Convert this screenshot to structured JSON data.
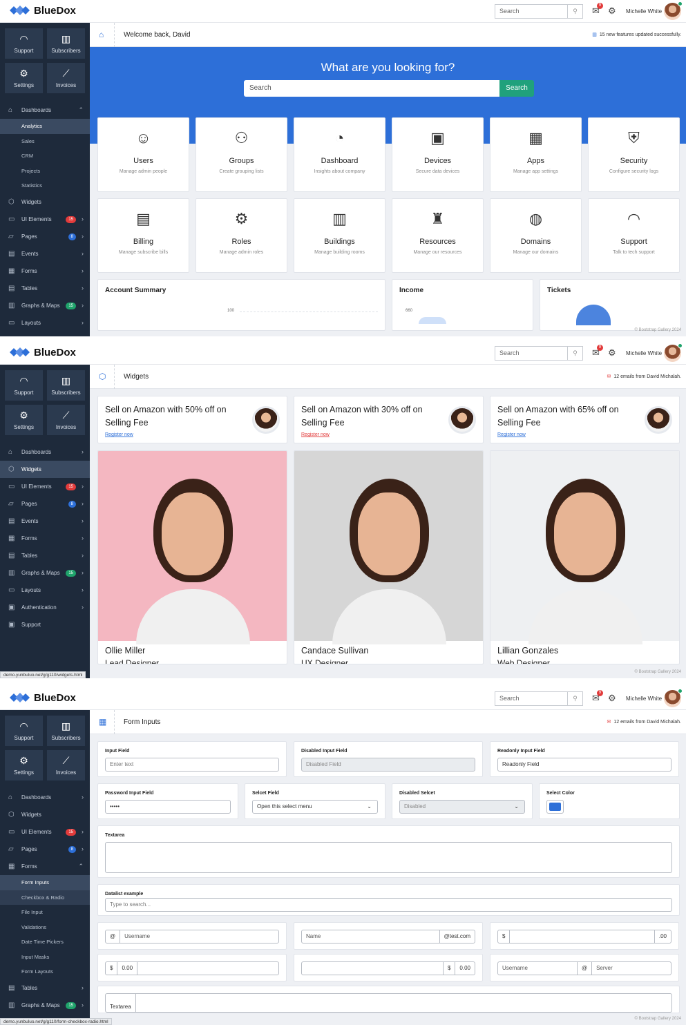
{
  "app": {
    "brand": "BlueDox",
    "user_name": "Michelle White",
    "search_placeholder": "Search",
    "notif_count": "9",
    "footer": "© Bootstrap Gallery 2024"
  },
  "quick": [
    {
      "label": "Support",
      "icon": "headset-icon"
    },
    {
      "label": "Subscribers",
      "icon": "bar-chart-icon"
    },
    {
      "label": "Settings",
      "icon": "gear-icon"
    },
    {
      "label": "Invoices",
      "icon": "line-chart-icon"
    }
  ],
  "screen1": {
    "crumb_title": "Welcome back, David",
    "crumb_right": "15 new features updated successfully.",
    "hero_title": "What are you looking for?",
    "hero_placeholder": "Search",
    "hero_button": "Search",
    "menu": [
      {
        "label": "Dashboards",
        "chevron": "⌃"
      },
      {
        "label": "Widgets"
      },
      {
        "label": "UI Elements",
        "badge": "15",
        "badge_color": "red",
        "chevron": "›"
      },
      {
        "label": "Pages",
        "badge": "8",
        "badge_color": "blue",
        "chevron": "›"
      },
      {
        "label": "Events",
        "chevron": "›"
      },
      {
        "label": "Forms",
        "chevron": "›"
      },
      {
        "label": "Tables",
        "chevron": "›"
      },
      {
        "label": "Graphs & Maps",
        "badge": "15",
        "badge_color": "green",
        "chevron": "›"
      },
      {
        "label": "Layouts",
        "chevron": "›"
      }
    ],
    "submenu": [
      "Analytics",
      "Sales",
      "CRM",
      "Projects",
      "Statistics"
    ],
    "tiles": [
      {
        "name": "Users",
        "desc": "Manage admin people",
        "icon": "users-icon"
      },
      {
        "name": "Groups",
        "desc": "Create grouping lists",
        "icon": "groups-icon"
      },
      {
        "name": "Dashboard",
        "desc": "Insights about company",
        "icon": "gauge-icon"
      },
      {
        "name": "Devices",
        "desc": "Secure data devices",
        "icon": "devices-icon"
      },
      {
        "name": "Apps",
        "desc": "Manage app settings",
        "icon": "apps-icon"
      },
      {
        "name": "Security",
        "desc": "Configure security logs",
        "icon": "security-icon"
      },
      {
        "name": "Billing",
        "desc": "Manage subscribe bills",
        "icon": "billing-icon"
      },
      {
        "name": "Roles",
        "desc": "Manage admin roles",
        "icon": "roles-icon"
      },
      {
        "name": "Buildings",
        "desc": "Manage building rooms",
        "icon": "buildings-icon"
      },
      {
        "name": "Resources",
        "desc": "Manage our resources",
        "icon": "resources-icon"
      },
      {
        "name": "Domains",
        "desc": "Manage our domains",
        "icon": "domains-icon"
      },
      {
        "name": "Support",
        "desc": "Talk to tech support",
        "icon": "support-icon"
      }
    ],
    "summary": {
      "title": "Account Summary",
      "tick": "100"
    },
    "income": {
      "title": "Income",
      "tick": "660"
    },
    "tickets": {
      "title": "Tickets"
    }
  },
  "screen2": {
    "crumb_title": "Widgets",
    "crumb_right": "12 emails from David Michalah.",
    "menu": [
      {
        "label": "Dashboards",
        "chevron": "›"
      },
      {
        "label": "Widgets"
      },
      {
        "label": "UI Elements",
        "badge": "15",
        "badge_color": "red",
        "chevron": "›"
      },
      {
        "label": "Pages",
        "badge": "8",
        "badge_color": "blue",
        "chevron": "›"
      },
      {
        "label": "Events",
        "chevron": "›"
      },
      {
        "label": "Forms",
        "chevron": "›"
      },
      {
        "label": "Tables",
        "chevron": "›"
      },
      {
        "label": "Graphs & Maps",
        "badge": "15",
        "badge_color": "green",
        "chevron": "›"
      },
      {
        "label": "Layouts",
        "chevron": "›"
      },
      {
        "label": "Authentication",
        "chevron": "›"
      },
      {
        "label": "Support"
      }
    ],
    "promos": [
      {
        "text": "Sell on Amazon with 50% off on Selling Fee",
        "link": "Register now",
        "link_color": "#2d6fd8"
      },
      {
        "text": "Sell on Amazon with 30% off on Selling Fee",
        "link": "Register now",
        "link_color": "#e23b3b"
      },
      {
        "text": "Sell on Amazon with 65% off on Selling Fee",
        "link": "Register now",
        "link_color": "#2d6fd8"
      }
    ],
    "people": [
      {
        "name": "Ollie Miller",
        "role": "Lead Designer",
        "bg": "#f4b7c1"
      },
      {
        "name": "Candace Sullivan",
        "role": "UX Designer",
        "bg": "#d6d6d6"
      },
      {
        "name": "Lillian Gonzales",
        "role": "Web Designer",
        "bg": "#eef0f2"
      }
    ],
    "url": "demo.yunbuluo.net/g/g110/widgets.html"
  },
  "screen3": {
    "crumb_title": "Form Inputs",
    "crumb_right": "12 emails from David Michalah.",
    "menu": [
      {
        "label": "Dashboards",
        "chevron": "›"
      },
      {
        "label": "Widgets"
      },
      {
        "label": "UI Elements",
        "badge": "15",
        "badge_color": "red",
        "chevron": "›"
      },
      {
        "label": "Pages",
        "badge": "8",
        "badge_color": "blue",
        "chevron": "›"
      },
      {
        "label": "Forms",
        "chevron": "⌃"
      }
    ],
    "submenu": [
      "Form Inputs",
      "Checkbox & Radio",
      "File Input",
      "Validations",
      "Date Time Pickers",
      "Input Masks",
      "Form Layouts"
    ],
    "menu_after": [
      {
        "label": "Tables",
        "chevron": "›"
      },
      {
        "label": "Graphs & Maps",
        "badge": "15",
        "badge_color": "green",
        "chevron": "›"
      }
    ],
    "fields": {
      "input_label": "Input Field",
      "input_placeholder": "Enter text",
      "disabled_label": "Disabled Input Field",
      "disabled_value": "Disabled Field",
      "readonly_label": "Readonly Input Field",
      "readonly_value": "Readonly Field",
      "password_label": "Password Input Field",
      "password_value": "•••••",
      "select_label": "Selcet Field",
      "select_value": "Open this select menu",
      "disabled_select_label": "Disabled Selcet",
      "disabled_select_value": "Disabled",
      "color_label": "Select Color",
      "color_value": "#2d6fd8",
      "textarea_label": "Textarea",
      "datalist_label": "Datalist example",
      "datalist_placeholder": "Type to search...",
      "g1_addon": "@",
      "g1_placeholder": "Username",
      "g2_placeholder": "Name",
      "g2_addon": "@test.com",
      "g3_addon": "$",
      "g3_suffix": ".00",
      "g4_addon": "$",
      "g4_value": "0.00",
      "g5_addon": "$",
      "g5_value": "0.00",
      "g6_user": "Username",
      "g6_at": "@",
      "g6_server": "Server",
      "g7_addon": "Textarea"
    },
    "url": "demo.yunbuluo.net/g/g110/form-checkbox-radio.html"
  }
}
